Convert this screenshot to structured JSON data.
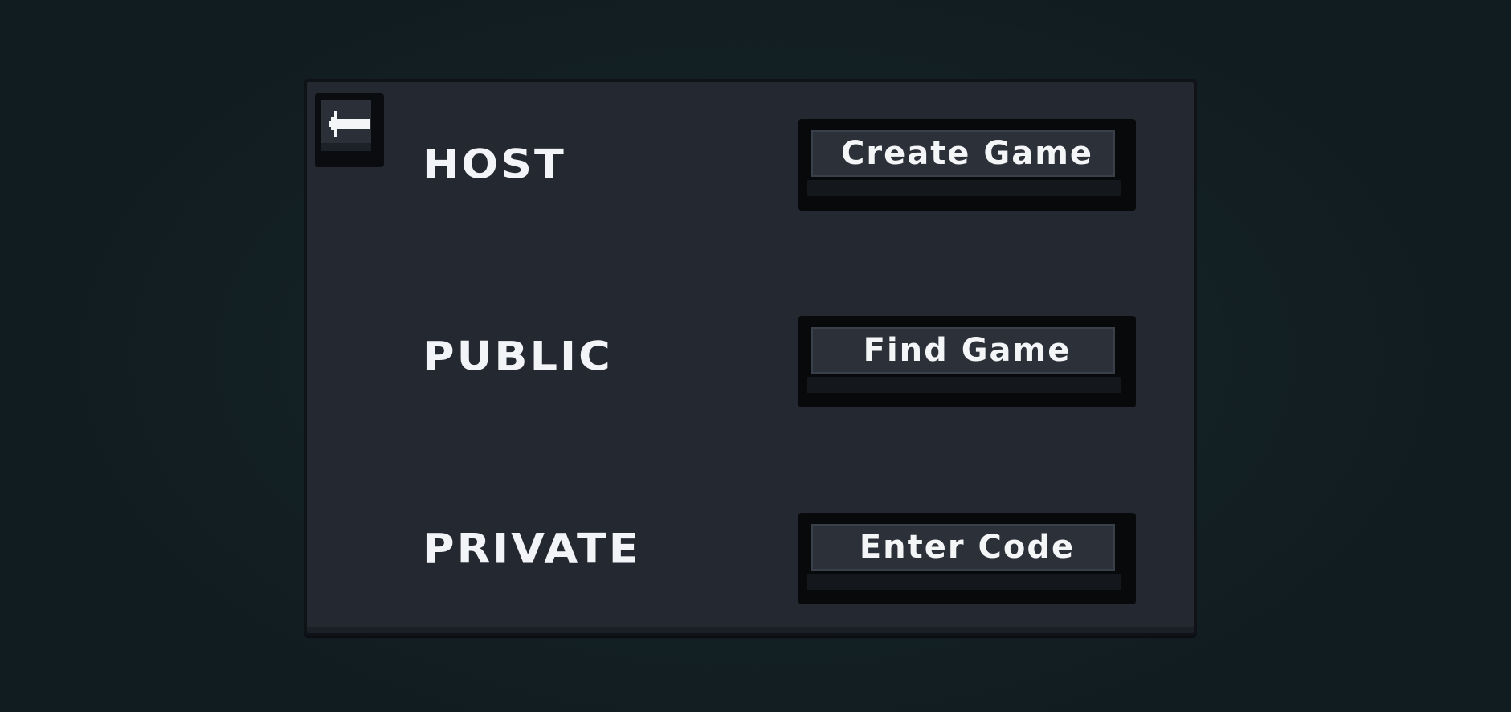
{
  "menu": {
    "back_icon": "arrow-left-icon",
    "rows": [
      {
        "label": "HOST",
        "button": "Create Game"
      },
      {
        "label": "PUBLIC",
        "button": "Find Game"
      },
      {
        "label": "PRIVATE",
        "button": "Enter Code"
      }
    ]
  },
  "colors": {
    "background": "#132024",
    "panel": "#242830",
    "button_face": "#2b3039",
    "text": "#f2f4f7"
  }
}
